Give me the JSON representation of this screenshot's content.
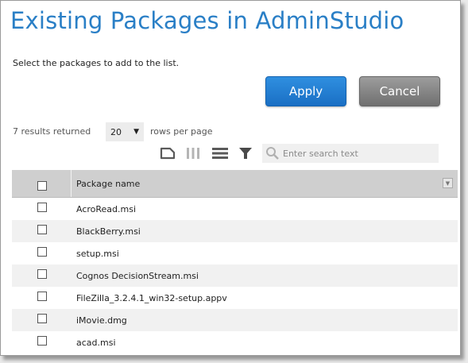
{
  "dialog": {
    "title": "Existing Packages in AdminStudio",
    "instruction": "Select the packages to add to the list.",
    "apply_label": "Apply",
    "cancel_label": "Cancel"
  },
  "paging": {
    "results_text": "7 results returned",
    "rows_per_page_value": "20",
    "rows_per_page_label": "rows per page"
  },
  "toolbar": {
    "icons": [
      "tag-icon",
      "columns-icon",
      "rows-icon",
      "filter-icon"
    ]
  },
  "search": {
    "placeholder": "Enter search text",
    "value": ""
  },
  "table": {
    "columns": [
      "Package name"
    ],
    "rows": [
      "AcroRead.msi",
      "BlackBerry.msi",
      "setup.msi",
      "Cognos DecisionStream.msi",
      "FileZilla_3.2.4.1_win32-setup.appv",
      "iMovie.dmg",
      "acad.msi"
    ]
  },
  "colors": {
    "title": "#2a7fc6",
    "apply": "#1f78cc",
    "cancel": "#7a7a7a",
    "header_bg": "#cfcfcf",
    "alt_row": "#f1f1f1"
  }
}
